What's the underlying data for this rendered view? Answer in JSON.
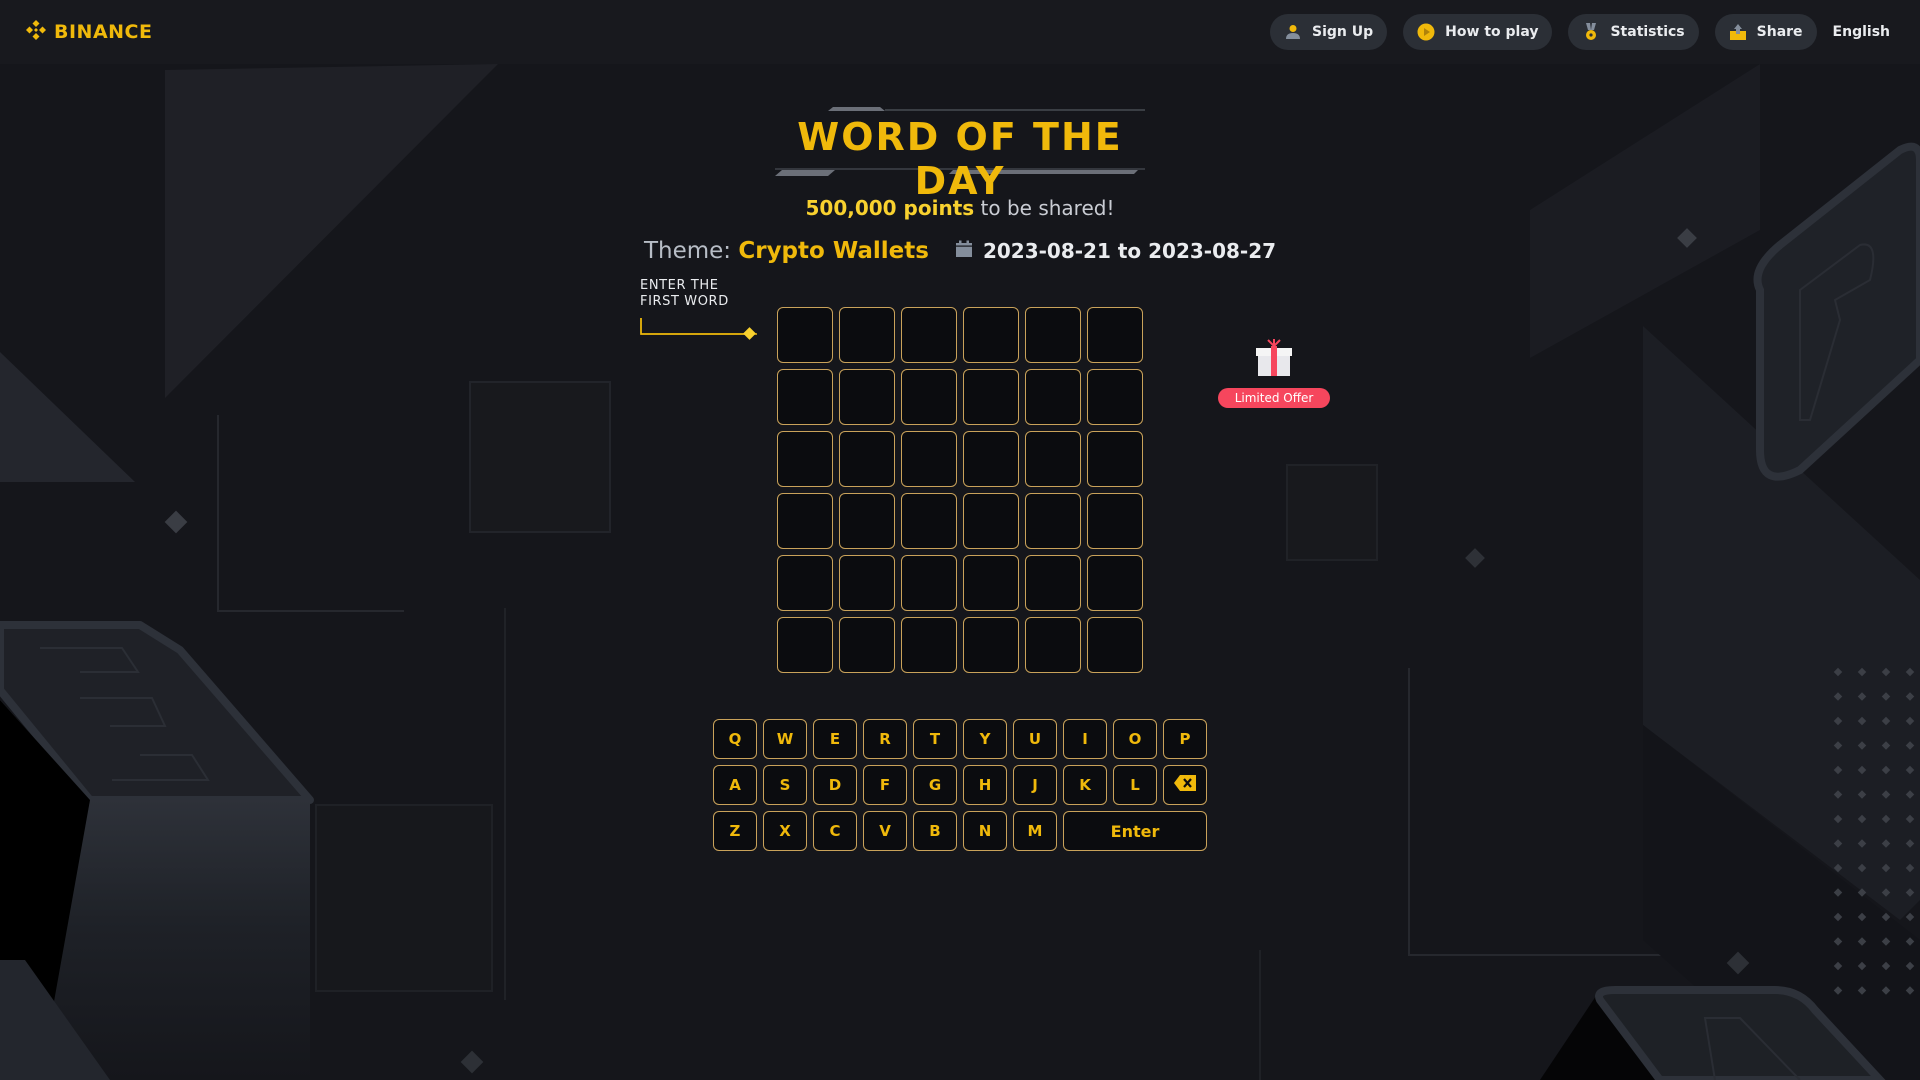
{
  "header": {
    "logo_text": "BINANCE",
    "nav": [
      {
        "id": "sign-up",
        "label": "Sign Up",
        "icon": "user-icon"
      },
      {
        "id": "how-to-play",
        "label": "How to play",
        "icon": "play-icon"
      },
      {
        "id": "statistics",
        "label": "Statistics",
        "icon": "medal-icon"
      },
      {
        "id": "share",
        "label": "Share",
        "icon": "share-icon"
      }
    ],
    "language": "English"
  },
  "game": {
    "title": "WORD OF THE DAY",
    "prize_amount": "500,000 points",
    "prize_suffix": " to be shared!",
    "theme_label": "Theme:",
    "theme_value": "Crypto Wallets",
    "date_range": "2023-08-21 to 2023-08-27",
    "hint_line1": "ENTER THE",
    "hint_line2": "FIRST WORD",
    "word_length": 6,
    "attempts": 6,
    "grid": [
      [
        "",
        "",
        "",
        "",
        "",
        ""
      ],
      [
        "",
        "",
        "",
        "",
        "",
        ""
      ],
      [
        "",
        "",
        "",
        "",
        "",
        ""
      ],
      [
        "",
        "",
        "",
        "",
        "",
        ""
      ],
      [
        "",
        "",
        "",
        "",
        "",
        ""
      ],
      [
        "",
        "",
        "",
        "",
        "",
        ""
      ]
    ]
  },
  "promo": {
    "label": "Limited Offer",
    "icon": "gift-icon"
  },
  "keyboard": {
    "rows": [
      [
        "Q",
        "W",
        "E",
        "R",
        "T",
        "Y",
        "U",
        "I",
        "O",
        "P"
      ],
      [
        "A",
        "S",
        "D",
        "F",
        "G",
        "H",
        "J",
        "K",
        "L",
        "BACKSPACE"
      ],
      [
        "Z",
        "X",
        "C",
        "V",
        "B",
        "N",
        "M",
        "Enter"
      ]
    ]
  },
  "colors": {
    "accent": "#f0b90b",
    "tile_border": "#c9a25a",
    "background": "#15161b",
    "offer": "#f6465d"
  }
}
